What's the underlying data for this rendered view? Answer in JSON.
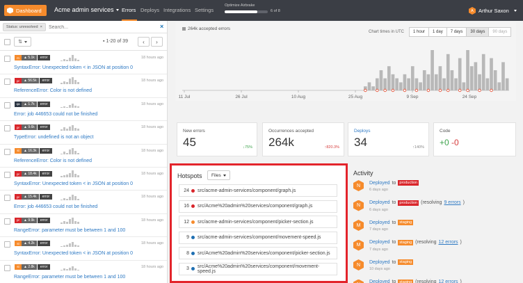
{
  "topbar": {
    "dashboard_label": "Dashboard",
    "app_name": "Acme admin services",
    "nav": [
      "Errors",
      "Deploys",
      "Integrations",
      "Settings"
    ],
    "optimize_label": "Optimize Airbrake",
    "optimize_count": "6 of 8",
    "optimize_progress": 0.75,
    "user_name": "Arthur Saxon",
    "user_initial": "A",
    "accent_color": "#f68b2c"
  },
  "filters": {
    "status_chip": "Status: unresolved",
    "search_placeholder": "Search..."
  },
  "pager": {
    "range": "1-20 of 39",
    "prev": "‹",
    "next": "›"
  },
  "errors": [
    {
      "stage": "m",
      "stage_color": "#f68b2c",
      "count": "5.1k",
      "level": "error",
      "time": "18 hours ago",
      "title": "SyntaxError: Unexpected token < in JSON at position 0",
      "spark": [
        1,
        3,
        2,
        5,
        9,
        4,
        2
      ]
    },
    {
      "stage": "pr",
      "stage_color": "#d9262b",
      "count": "56.5k",
      "level": "error",
      "time": "18 hours ago",
      "title": "ReferenceError: Color is not defined",
      "spark": [
        2,
        4,
        3,
        8,
        10,
        6,
        3
      ]
    },
    {
      "stage": "qa",
      "stage_color": "#2d3643",
      "count": "1.7k",
      "level": "error",
      "time": "18 hours ago",
      "title": "Error: job 446653 could not be finished",
      "spark": [
        1,
        2,
        1,
        4,
        6,
        3,
        2
      ]
    },
    {
      "stage": "pr",
      "stage_color": "#d9262b",
      "count": "9.6k",
      "level": "error",
      "time": "18 hours ago",
      "title": "TypeError: undefined is not an object",
      "spark": [
        2,
        5,
        3,
        6,
        8,
        4,
        3
      ]
    },
    {
      "stage": "st",
      "stage_color": "#f68b2c",
      "count": "16.3k",
      "level": "error",
      "time": "18 hours ago",
      "title": "ReferenceError: Color is not defined",
      "spark": [
        1,
        4,
        2,
        7,
        9,
        5,
        2
      ]
    },
    {
      "stage": "pr",
      "stage_color": "#d9262b",
      "count": "18.4k",
      "level": "error",
      "time": "18 hours ago",
      "title": "SyntaxError: Unexpected token < in JSON at position 0",
      "spark": [
        2,
        3,
        4,
        6,
        10,
        5,
        3
      ]
    },
    {
      "stage": "pr",
      "stage_color": "#d9262b",
      "count": "15.4k",
      "level": "error",
      "time": "18 hours ago",
      "title": "Error: job 446653 could not be finished",
      "spark": [
        1,
        3,
        2,
        5,
        8,
        6,
        2
      ]
    },
    {
      "stage": "pr",
      "stage_color": "#d9262b",
      "count": "9.9k",
      "level": "error",
      "time": "18 hours ago",
      "title": "RangeError: parameter must be between 1 and 100",
      "spark": [
        2,
        4,
        3,
        7,
        9,
        4,
        3
      ]
    },
    {
      "stage": "st",
      "stage_color": "#f68b2c",
      "count": "4.2k",
      "level": "error",
      "time": "18 hours ago",
      "title": "SyntaxError: Unexpected token < in JSON at position 0",
      "spark": [
        1,
        2,
        3,
        5,
        7,
        3,
        2
      ]
    },
    {
      "stage": "st",
      "stage_color": "#f68b2c",
      "count": "2.8k",
      "level": "error",
      "time": "18 hours ago",
      "title": "RangeError: parameter must be between 1 and 100",
      "spark": [
        1,
        3,
        2,
        4,
        6,
        3,
        1
      ]
    }
  ],
  "chart": {
    "legend_label": "264k accepted errors",
    "times_label": "Chart times in UTC",
    "ranges": [
      "1 hour",
      "1 day",
      "7 days",
      "30 days",
      "90 days"
    ],
    "active_range": "30 days",
    "x_ticks": [
      "11 Jul",
      "26 Jul",
      "10 Aug",
      "25 Aug",
      "9 Sep",
      "24 Sep"
    ]
  },
  "chart_data": {
    "type": "bar",
    "title": "",
    "values": [
      0,
      0,
      0,
      0,
      0,
      0,
      0,
      0,
      0,
      0,
      0,
      0,
      0,
      0,
      0,
      0,
      0,
      0,
      0,
      0,
      0,
      0,
      0,
      0,
      0,
      0,
      0,
      0,
      0,
      0,
      0,
      0,
      0,
      0,
      0,
      0,
      0,
      0,
      0,
      0,
      0,
      0,
      0,
      0,
      0,
      0,
      1,
      2,
      1,
      3,
      5,
      3,
      6,
      4,
      3,
      2,
      4,
      3,
      6,
      3,
      2,
      5,
      4,
      10,
      4,
      6,
      3,
      9,
      5,
      3,
      8,
      2,
      10,
      6,
      7,
      4,
      9,
      3,
      8,
      5,
      2,
      7,
      3
    ],
    "deploy_markers": [
      46,
      49,
      51,
      53,
      56,
      59,
      62,
      65,
      67,
      70,
      72,
      75,
      78
    ],
    "grid": false
  },
  "stats": [
    {
      "label": "New errors",
      "value": "45",
      "trend": "75%",
      "trend_dir": "down",
      "trend_color": "#3fa34d"
    },
    {
      "label": "Occurrences accepted",
      "value": "264k",
      "trend": "820.3%",
      "trend_dir": "up",
      "trend_color": "#d63b3b"
    },
    {
      "label": "Deploys",
      "value": "34",
      "trend": "140%",
      "trend_dir": "up",
      "trend_color": "#888888"
    },
    {
      "label": "Code",
      "plus": "+0",
      "minus": "-0"
    }
  ],
  "hotspots": {
    "title": "Hotspots",
    "files_label": "Files",
    "items": [
      {
        "count": "24",
        "color": "#d9262b",
        "path": "src/acme-admin-services/component/graph.js"
      },
      {
        "count": "16",
        "color": "#d9262b",
        "path": "src/Acme%20admin%20services/component/graph.js"
      },
      {
        "count": "12",
        "color": "#f68b2c",
        "path": "src/acme-admin-services/component/picker-section.js"
      },
      {
        "count": "9",
        "color": "#1f6fb2",
        "path": "src/acme-admin-services/component/movement-speed.js"
      },
      {
        "count": "8",
        "color": "#1f6fb2",
        "path": "src/Acme%20admin%20services/component/picker-section.js"
      },
      {
        "count": "3",
        "color": "#1f6fb2",
        "path": "src/Acme%20admin%20services/component/movement-speed.js"
      }
    ]
  },
  "activity": {
    "title": "Activity",
    "items": [
      {
        "initial": "N",
        "action": "Deployed",
        "to": "to",
        "env": "production",
        "env_color": "#d9262b",
        "extra": "",
        "link": "",
        "time": "6 days ago"
      },
      {
        "initial": "N",
        "action": "Deployed",
        "to": "to",
        "env": "production",
        "env_color": "#d9262b",
        "extra": "(resolving",
        "link": "9 errors",
        "time": "6 days ago"
      },
      {
        "initial": "M",
        "action": "Deployed",
        "to": "to",
        "env": "staging",
        "env_color": "#f68b2c",
        "extra": "",
        "link": "",
        "time": "7 days ago"
      },
      {
        "initial": "M",
        "action": "Deployed",
        "to": "to",
        "env": "staging",
        "env_color": "#f68b2c",
        "extra": "(resolving",
        "link": "12 errors",
        "time": "7 days ago"
      },
      {
        "initial": "N",
        "action": "Deployed",
        "to": "to",
        "env": "staging",
        "env_color": "#f68b2c",
        "extra": "",
        "link": "",
        "time": "10 days ago"
      },
      {
        "initial": "N",
        "action": "Deployed",
        "to": "to",
        "env": "staging",
        "env_color": "#f68b2c",
        "extra": "(resolving",
        "link": "12 errors",
        "time": ""
      }
    ]
  }
}
